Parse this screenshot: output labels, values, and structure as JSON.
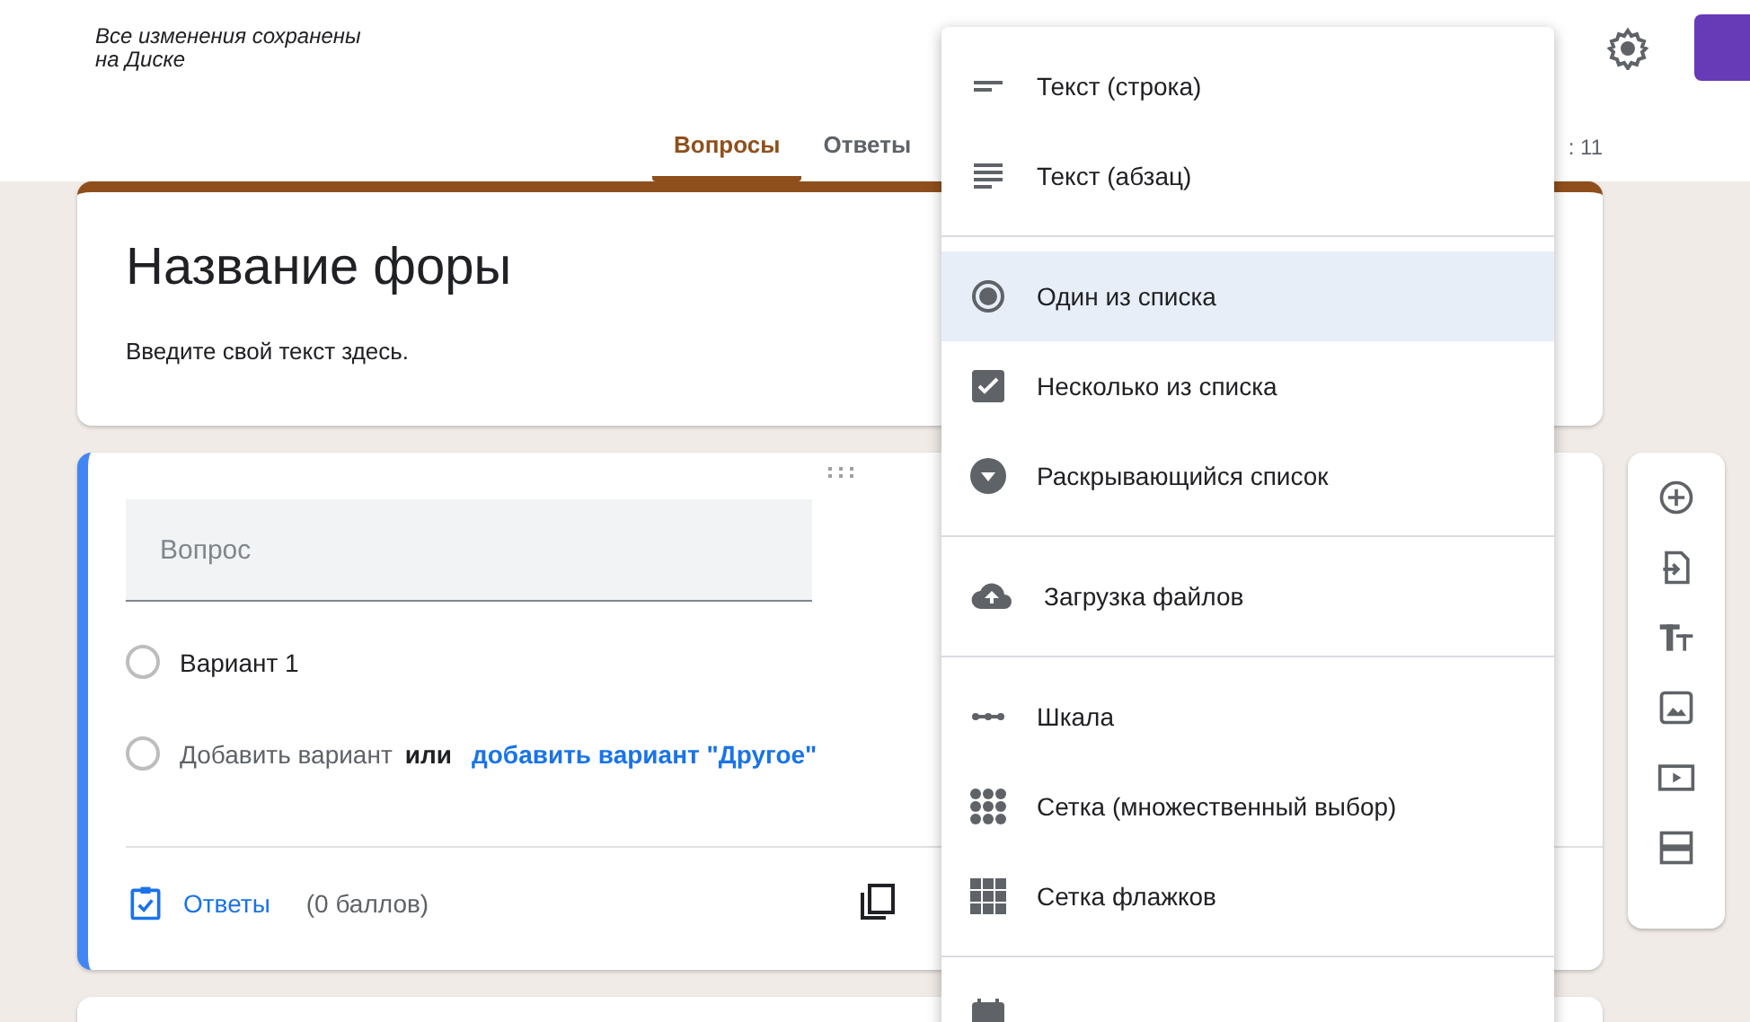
{
  "header": {
    "save_status": "Все изменения сохранены\nна Диске",
    "tabs": [
      {
        "label": "Вопросы",
        "selected": true
      },
      {
        "label": "Ответы",
        "selected": false
      }
    ],
    "total_points": ": 11"
  },
  "form": {
    "title": "Название форы",
    "description": "Введите свой текст здесь."
  },
  "question": {
    "placeholder": "Вопрос",
    "options": [
      {
        "label": "Вариант 1",
        "selected": false
      }
    ],
    "add_option": "Добавить вариант",
    "add_option_selected": false,
    "or": "или",
    "add_other": "добавить вариант \"Другое\"",
    "answer_key": "Ответы",
    "points": "(0 баллов)"
  },
  "menu": {
    "sections": [
      [
        {
          "kind": "short",
          "label": "Текст (строка)",
          "selected": false
        },
        {
          "kind": "paragraph",
          "label": "Текст (абзац)",
          "selected": false
        }
      ],
      [
        {
          "kind": "radio",
          "label": "Один из списка",
          "selected": true
        },
        {
          "kind": "checkbox",
          "label": "Несколько из списка",
          "selected": false
        },
        {
          "kind": "dropdown",
          "label": "Раскрывающийся список",
          "selected": false
        }
      ],
      [
        {
          "kind": "upload",
          "label": "Загрузка файлов",
          "selected": false
        }
      ],
      [
        {
          "kind": "scale",
          "label": "Шкала",
          "selected": false
        },
        {
          "kind": "grid",
          "label": "Сетка (множественный выбор)",
          "selected": false
        },
        {
          "kind": "checkgrid",
          "label": "Сетка флажков",
          "selected": false
        }
      ]
    ]
  }
}
